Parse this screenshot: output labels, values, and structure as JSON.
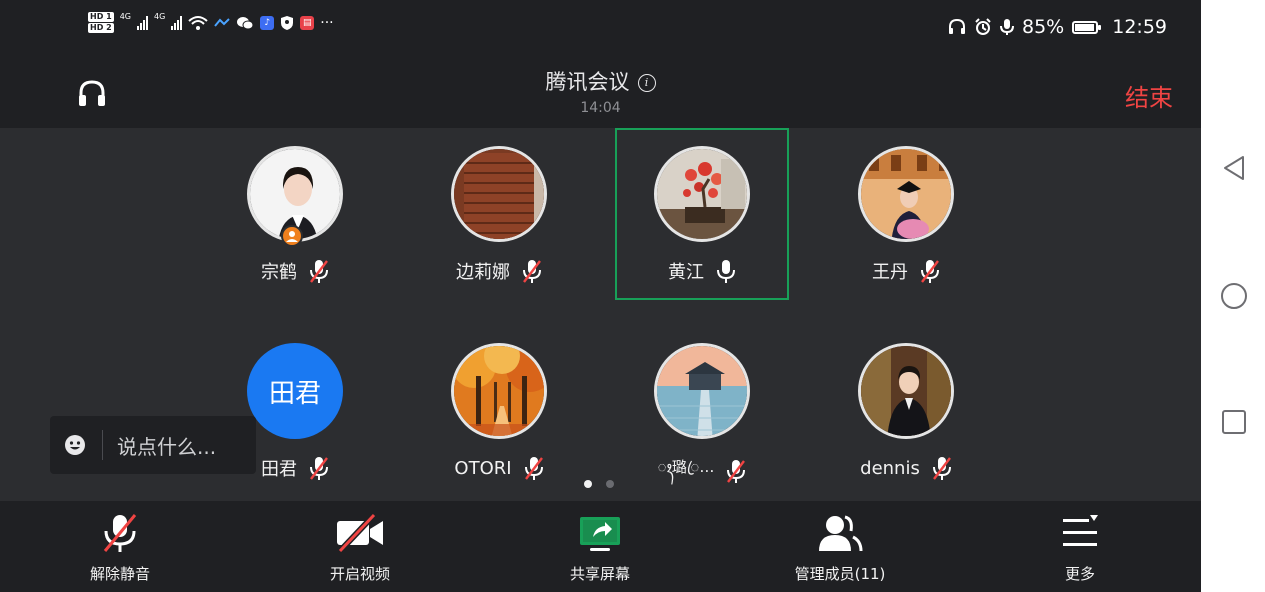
{
  "status_bar": {
    "hd1": "HD 1",
    "hd2": "HD 2",
    "net1": "4G",
    "net2": "4G",
    "more": "···",
    "battery": "85%",
    "time": "12:59"
  },
  "header": {
    "title": "腾讯会议",
    "duration": "14:04",
    "end_label": "结束"
  },
  "participants": [
    {
      "name": "宗鹤",
      "mic": "muted",
      "avatar": "photo-woman-suit",
      "host": true
    },
    {
      "name": "边莉娜",
      "mic": "muted",
      "avatar": "photo-brown-door"
    },
    {
      "name": "黄江",
      "mic": "speaking",
      "avatar": "photo-bonsai",
      "active": true
    },
    {
      "name": "王丹",
      "mic": "muted",
      "avatar": "photo-graduate"
    },
    {
      "name": "田君",
      "mic": "muted",
      "avatar_text": "田君",
      "avatar_color": "#1a79f2"
    },
    {
      "name": "OTORI",
      "mic": "muted",
      "avatar": "photo-autumn-forest"
    },
    {
      "name": "ꦃ璐ꦿ…",
      "mic": "muted",
      "avatar": "photo-pier-sunset"
    },
    {
      "name": "dennis",
      "mic": "muted",
      "avatar": "photo-man-suit"
    }
  ],
  "page_indicator": {
    "pages": 2,
    "current": 1
  },
  "chat": {
    "placeholder": "说点什么..."
  },
  "toolbar": {
    "unmute": "解除静音",
    "video": "开启视频",
    "share": "共享屏幕",
    "members": "管理成员(11)",
    "more": "更多"
  },
  "colors": {
    "accent_red": "#f04443",
    "active_green": "#18a058",
    "share_green": "#18a058",
    "avatar_blue": "#1a79f2",
    "host_orange": "#f0801e"
  }
}
